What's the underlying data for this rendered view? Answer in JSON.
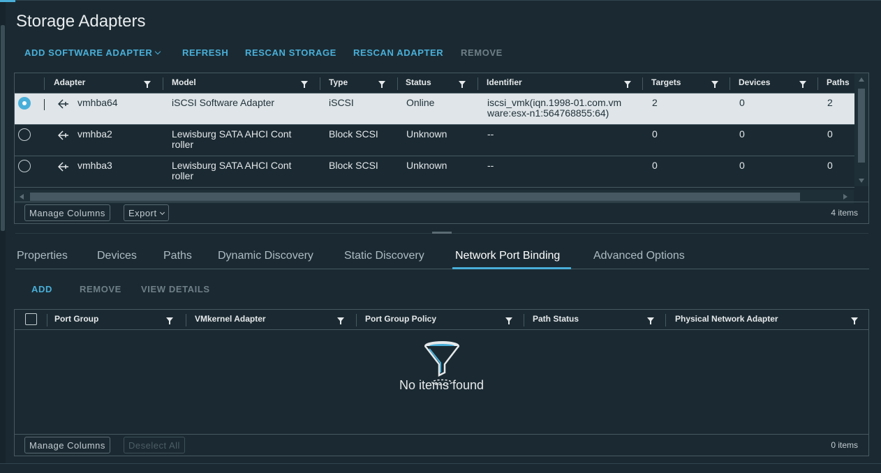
{
  "page": {
    "title": "Storage Adapters"
  },
  "toolbar": {
    "add_software_adapter": "ADD SOFTWARE ADAPTER",
    "refresh": "REFRESH",
    "rescan_storage": "RESCAN STORAGE",
    "rescan_adapter": "RESCAN ADAPTER",
    "remove": "REMOVE"
  },
  "adapters_grid": {
    "columns": [
      "Adapter",
      "Model",
      "Type",
      "Status",
      "Identifier",
      "Targets",
      "Devices",
      "Paths"
    ],
    "rows": [
      {
        "adapter": "vmhba64",
        "model_1": "iSCSI Software Adapter",
        "model_2": "",
        "type": "iSCSI",
        "status": "Online",
        "identifier_1": "iscsi_vmk(iqn.1998-01.com.vm",
        "identifier_2": "ware:esx-n1:564768855:64)",
        "targets": "2",
        "devices": "0",
        "paths": "2",
        "selected": true
      },
      {
        "adapter": "vmhba2",
        "model_1": "Lewisburg SATA AHCI Cont",
        "model_2": "roller",
        "type": "Block SCSI",
        "status": "Unknown",
        "identifier_1": "--",
        "identifier_2": "",
        "targets": "0",
        "devices": "0",
        "paths": "0",
        "selected": false
      },
      {
        "adapter": "vmhba3",
        "model_1": "Lewisburg SATA AHCI Cont",
        "model_2": "roller",
        "type": "Block SCSI",
        "status": "Unknown",
        "identifier_1": "--",
        "identifier_2": "",
        "targets": "0",
        "devices": "0",
        "paths": "0",
        "selected": false
      }
    ],
    "footer": {
      "manage_columns": "Manage Columns",
      "export": "Export",
      "count": "4 items"
    }
  },
  "tabs": [
    "Properties",
    "Devices",
    "Paths",
    "Dynamic Discovery",
    "Static Discovery",
    "Network Port Binding",
    "Advanced Options"
  ],
  "active_tab": "Network Port Binding",
  "binding_actions": {
    "add": "ADD",
    "remove": "REMOVE",
    "view_details": "VIEW DETAILS"
  },
  "binding_grid": {
    "columns": [
      "Port Group",
      "VMkernel Adapter",
      "Port Group Policy",
      "Path Status",
      "Physical Network Adapter"
    ],
    "empty_text": "No items found",
    "footer": {
      "manage_columns": "Manage Columns",
      "deselect_all": "Deselect All",
      "count": "0 items"
    }
  },
  "colors": {
    "accent": "#49afd9",
    "background": "#1b2a32",
    "selected_row": "#dfe5e8"
  }
}
